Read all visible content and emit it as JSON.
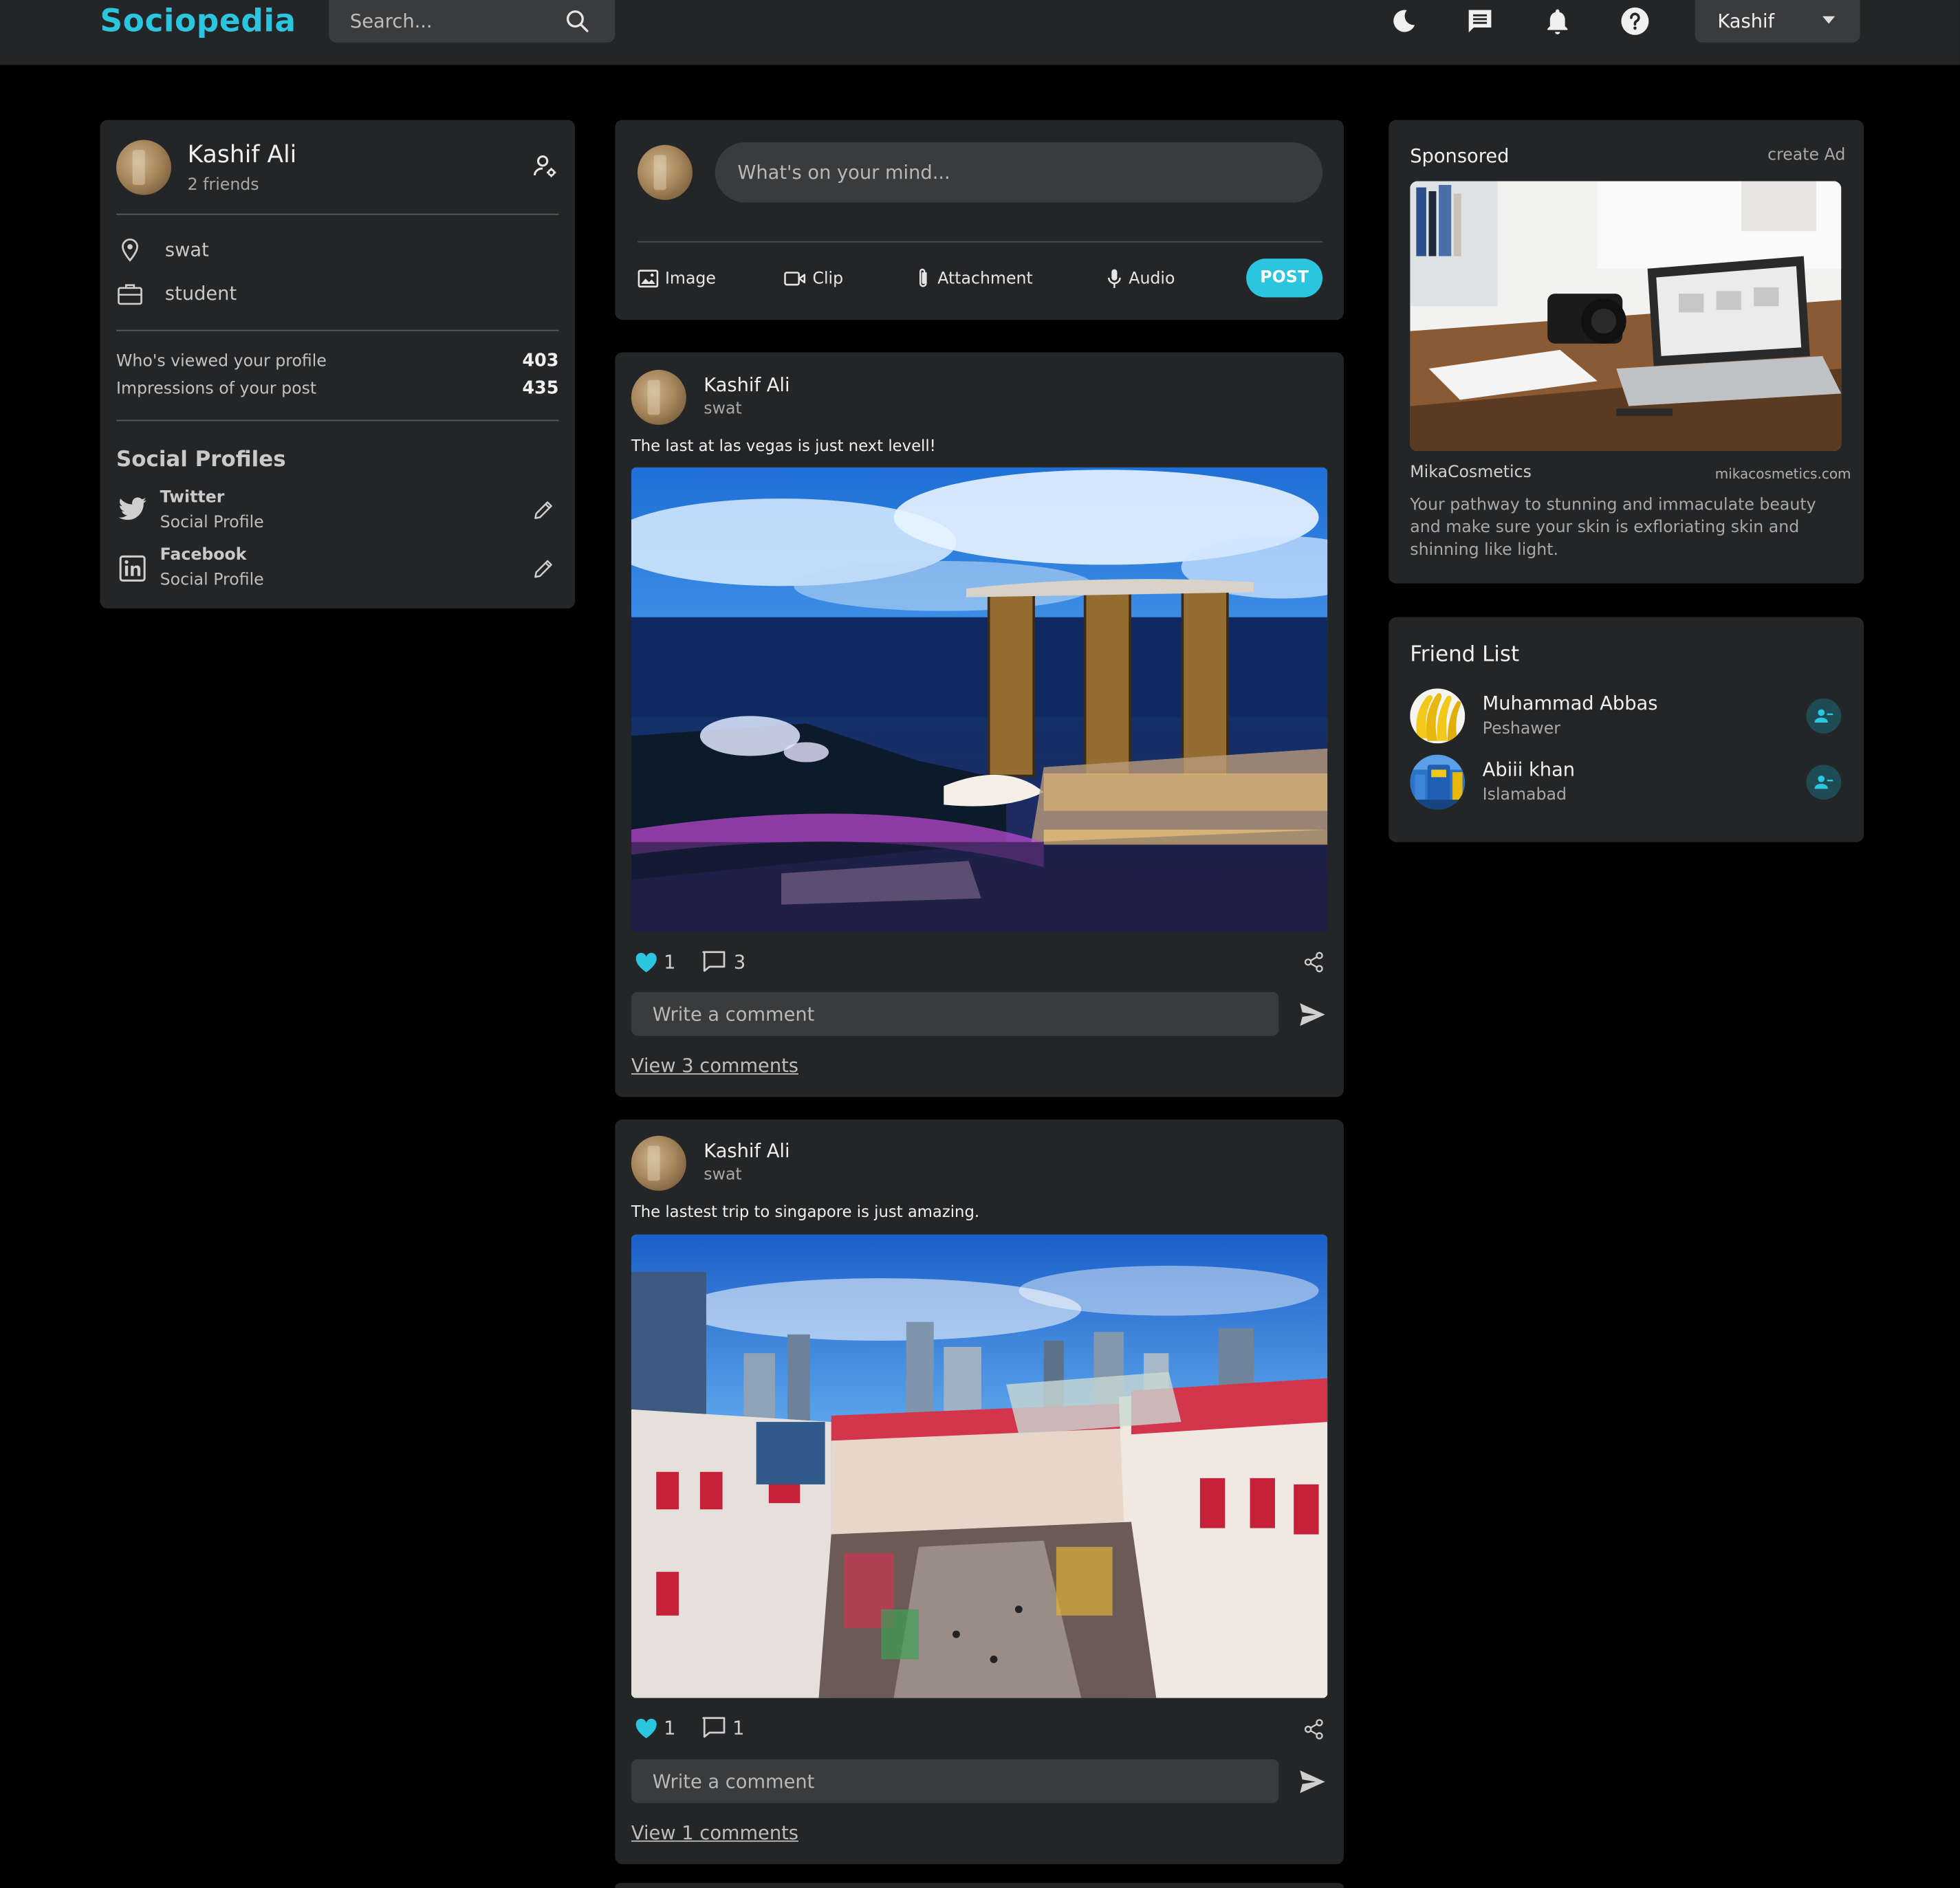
{
  "app": {
    "name": "Sociopedia"
  },
  "search": {
    "placeholder": "Search..."
  },
  "header": {
    "user_name": "Kashif"
  },
  "profile": {
    "name": "Kashif Ali",
    "friends": "2 friends",
    "location": "swat",
    "occupation": "student",
    "stats": [
      {
        "label": "Who's viewed your profile",
        "value": "403"
      },
      {
        "label": "Impressions of your post",
        "value": "435"
      }
    ],
    "social_title": "Social Profiles",
    "socials": [
      {
        "name": "Twitter",
        "sub": "Social Profile"
      },
      {
        "name": "Facebook",
        "sub": "Social Profile"
      }
    ]
  },
  "composer": {
    "placeholder": "What's on your mind...",
    "tools": [
      "Image",
      "Clip",
      "Attachment",
      "Audio"
    ],
    "post_label": "POST"
  },
  "posts": [
    {
      "author": "Kashif Ali",
      "location": "swat",
      "description": "The last at las vegas is just next levell!",
      "likes": "1",
      "comments": "3",
      "comment_placeholder": "Write a comment",
      "view_comments": "View 3 comments"
    },
    {
      "author": "Kashif Ali",
      "location": "swat",
      "description": "The lastest trip to singapore is just amazing.",
      "likes": "1",
      "comments": "1",
      "comment_placeholder": "Write a comment",
      "view_comments": "View 1 comments"
    }
  ],
  "sponsored": {
    "title": "Sponsored",
    "create_label": "create Ad",
    "brand": "MikaCosmetics",
    "domain": "mikacosmetics.com",
    "description": "Your pathway to stunning and immaculate beauty and make sure your skin is exfloriating skin and shinning like light."
  },
  "friends": {
    "title": "Friend List",
    "items": [
      {
        "name": "Muhammad Abbas",
        "location": "Peshawer"
      },
      {
        "name": "Abiii khan",
        "location": "Islamabad"
      }
    ]
  },
  "colors": {
    "accent": "#2bc5e0",
    "card": "#242526",
    "background": "#000000",
    "input": "#3a3b3c"
  }
}
